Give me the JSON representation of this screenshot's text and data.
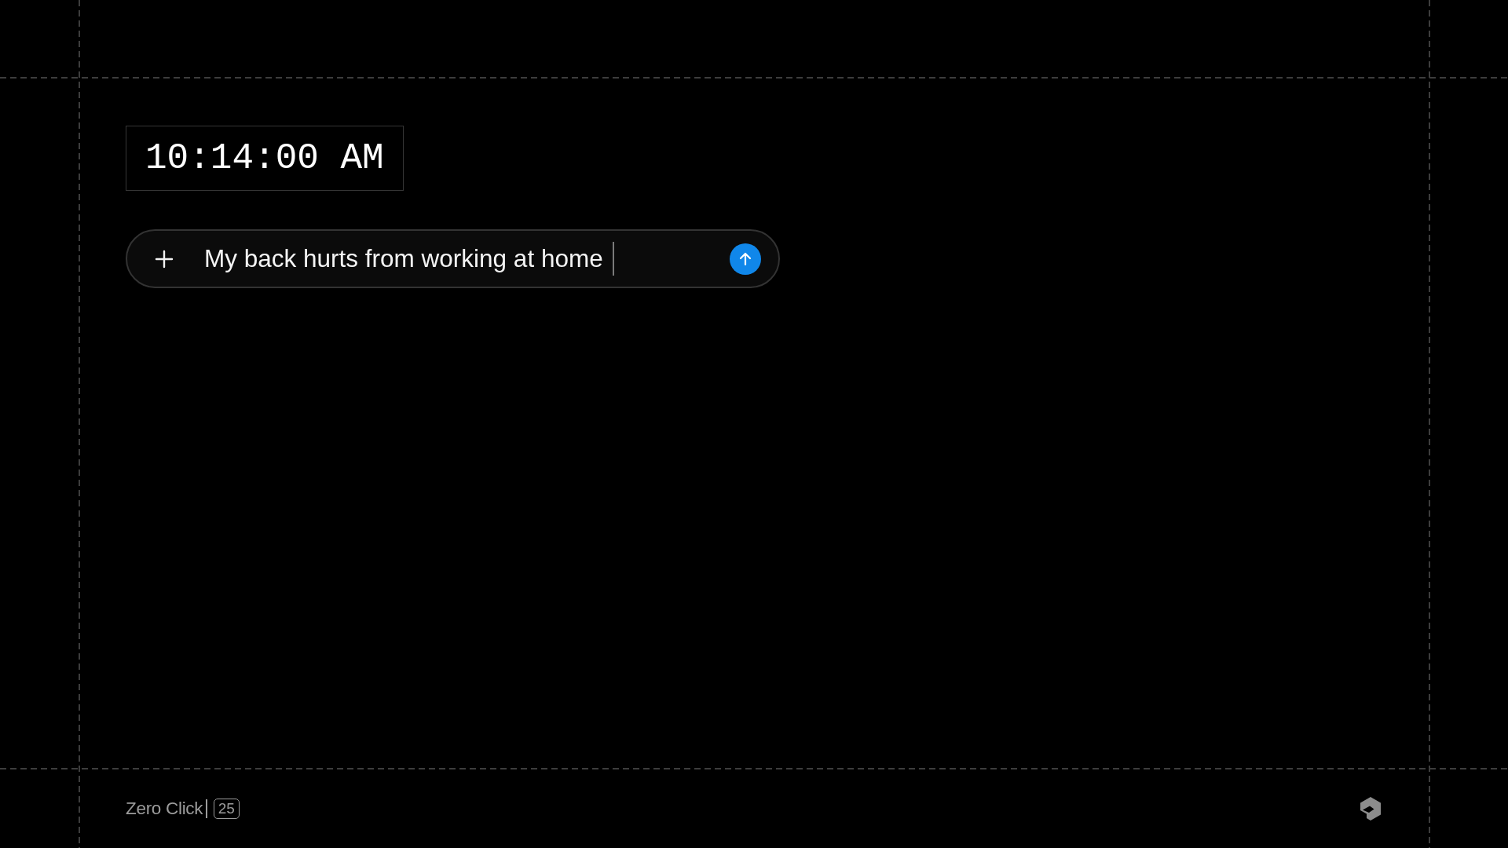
{
  "clock": {
    "time": "10:14:00 AM"
  },
  "composer": {
    "value": "My back hurts from working at home",
    "focused": true
  },
  "footer": {
    "brand": "Zero Click",
    "badge": "25"
  }
}
